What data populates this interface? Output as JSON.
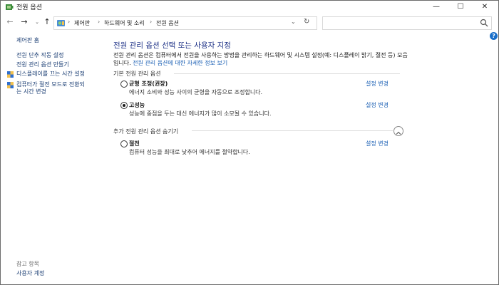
{
  "window": {
    "title": "전원 옵션",
    "controls": {
      "minimize": "—",
      "maximize": "☐",
      "close": "✕"
    }
  },
  "nav": {
    "back": "←",
    "forward": "→",
    "history": "⌄",
    "up": "↑",
    "breadcrumb": [
      "제어판",
      "하드웨어 및 소리",
      "전원 옵션"
    ],
    "breadcrumb_sep": "›",
    "dropdown": "⌄",
    "refresh": "↻",
    "search_placeholder": ""
  },
  "help": "?",
  "sidebar": {
    "home": "제어판 홈",
    "items": [
      {
        "label": "전원 단추 작동 설정",
        "icon": ""
      },
      {
        "label": "전원 관리 옵션 만들기",
        "icon": ""
      },
      {
        "label": "디스플레이를 끄는 시간 설정",
        "icon": "shield-icon"
      },
      {
        "label_lines": [
          "컴퓨터가 절전 모드로 전환되",
          "는 시간 변경"
        ],
        "icon": "shield-icon"
      }
    ],
    "see_also_title": "참고 항목",
    "see_also": [
      "사용자 계정"
    ]
  },
  "main": {
    "heading": "전원 관리 옵션 선택 또는 사용자 지정",
    "description": "전원 관리 옵션은 컴퓨터에서 전원을 사용하는 방법을 관리하는 하드웨어 및 시스템 설정(예: 디스플레이 밝기, 절전 등) 모음입니다.",
    "description_link": "전원 관리 옵션에 대한 자세한 정보 보기",
    "preferred_section": "기본 전원 관리 옵션",
    "hidden_section": "추가 전원 관리 옵션 숨기기",
    "plans": [
      {
        "name": "균형 조정(권장)",
        "desc": "에너지 소비와 성능 사이의 균형을 자동으로 조정합니다.",
        "checked": false,
        "change": "설정 변경"
      },
      {
        "name": "고성능",
        "desc": "성능에 중점을 두는 대신 에너지가 많이 소모될 수 있습니다.",
        "checked": true,
        "change": "설정 변경"
      },
      {
        "name": "절전",
        "desc": "컴퓨터 성능을 최대로 낮추어 에너지를 절약합니다.",
        "checked": false,
        "change": "설정 변경"
      }
    ]
  }
}
